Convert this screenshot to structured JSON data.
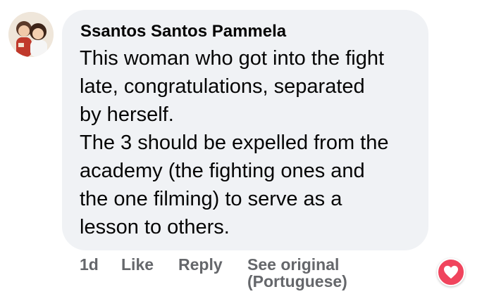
{
  "comment": {
    "author": "Ssantos Santos Pammela",
    "lines": [
      "This woman who got into the fight",
      "late, congratulations, separated",
      "by herself.",
      "The 3 should be expelled from the",
      "academy (the fighting ones and",
      "the one filming) to serve as a",
      "lesson to others."
    ],
    "time": "1d",
    "like_label": "Like",
    "reply_label": "Reply",
    "see_original_lines": [
      "See original",
      "(Portuguese)"
    ],
    "reaction_icon": "heart-icon"
  },
  "colors": {
    "bubble": "#f0f2f5",
    "text": "#050505",
    "meta": "#65676b",
    "heart": "#f0445d"
  }
}
